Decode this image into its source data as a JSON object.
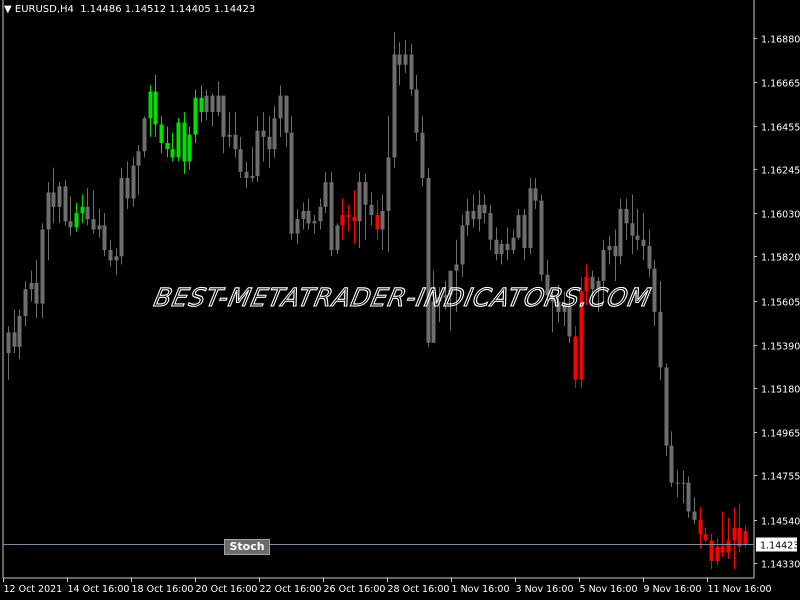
{
  "header": {
    "symbol_timeframe": "EURUSD,H4",
    "open": "1.14486",
    "high": "1.14512",
    "low": "1.14405",
    "close": "1.14423"
  },
  "colors": {
    "background": "#000000",
    "axis": "#c8c8c8",
    "neutral_candle": "#6e6e6e",
    "bull_signal_candle": "#00e000",
    "bear_signal_candle": "#ff0000",
    "price_line": "#7f8fa6",
    "watermark": "#ffffff"
  },
  "watermark_text": "BEST-METATRADER-INDICATORS.COM",
  "stoch_button_label": "Stoch",
  "current_price_label": "1.14423",
  "chart_data": {
    "type": "candlestick",
    "title": "EURUSD,H4",
    "ylim": [
      1.1418,
      1.1703
    ],
    "y_ticks": [
      "1.16880",
      "1.16665",
      "1.16455",
      "1.16245",
      "1.16030",
      "1.15820",
      "1.15605",
      "1.15390",
      "1.15180",
      "1.14965",
      "1.14755",
      "1.14540",
      "1.14330"
    ],
    "x_ticks": [
      "12 Oct 2021",
      "14 Oct 16:00",
      "18 Oct 16:00",
      "20 Oct 16:00",
      "22 Oct 16:00",
      "26 Oct 16:00",
      "28 Oct 16:00",
      "1 Nov 16:00",
      "3 Nov 16:00",
      "5 Nov 16:00",
      "9 Nov 16:00",
      "11 Nov 16:00"
    ],
    "current_price": 1.14423,
    "candles": [
      [
        1.1535,
        1.1548,
        1.1522,
        1.1545,
        "n"
      ],
      [
        1.1545,
        1.1556,
        1.1535,
        1.1538,
        "n"
      ],
      [
        1.1538,
        1.1556,
        1.1532,
        1.1553,
        "n"
      ],
      [
        1.1553,
        1.157,
        1.1548,
        1.1566,
        "n"
      ],
      [
        1.1566,
        1.1575,
        1.156,
        1.1569,
        "n"
      ],
      [
        1.1569,
        1.158,
        1.1552,
        1.1559,
        "n"
      ],
      [
        1.1559,
        1.1598,
        1.1552,
        1.1595,
        "n"
      ],
      [
        1.1595,
        1.1618,
        1.158,
        1.1613,
        "n"
      ],
      [
        1.1613,
        1.1625,
        1.1598,
        1.1606,
        "n"
      ],
      [
        1.1606,
        1.1618,
        1.1598,
        1.1616,
        "n"
      ],
      [
        1.1616,
        1.1619,
        1.1597,
        1.1599,
        "n"
      ],
      [
        1.1599,
        1.1611,
        1.1592,
        1.1596,
        "n"
      ],
      [
        1.1596,
        1.1608,
        1.1594,
        1.1603,
        "g"
      ],
      [
        1.1603,
        1.1612,
        1.1598,
        1.1606,
        "g"
      ],
      [
        1.1606,
        1.1615,
        1.1597,
        1.16,
        "n"
      ],
      [
        1.16,
        1.1614,
        1.1593,
        1.1595,
        "n"
      ],
      [
        1.1595,
        1.1605,
        1.1591,
        1.1597,
        "n"
      ],
      [
        1.1597,
        1.1603,
        1.1582,
        1.1585,
        "n"
      ],
      [
        1.1585,
        1.159,
        1.1577,
        1.158,
        "n"
      ],
      [
        1.158,
        1.1586,
        1.1573,
        1.1582,
        "n"
      ],
      [
        1.1582,
        1.1625,
        1.1578,
        1.162,
        "n"
      ],
      [
        1.162,
        1.1628,
        1.1605,
        1.161,
        "n"
      ],
      [
        1.161,
        1.163,
        1.1606,
        1.1626,
        "n"
      ],
      [
        1.1626,
        1.1636,
        1.1612,
        1.1633,
        "n"
      ],
      [
        1.1633,
        1.165,
        1.163,
        1.1649,
        "n"
      ],
      [
        1.1649,
        1.1665,
        1.164,
        1.1662,
        "g"
      ],
      [
        1.1662,
        1.167,
        1.164,
        1.1646,
        "g"
      ],
      [
        1.1646,
        1.165,
        1.1632,
        1.1637,
        "g"
      ],
      [
        1.1637,
        1.1645,
        1.163,
        1.1634,
        "g"
      ],
      [
        1.1634,
        1.1642,
        1.1628,
        1.163,
        "g"
      ],
      [
        1.163,
        1.1649,
        1.1628,
        1.1647,
        "g"
      ],
      [
        1.1647,
        1.1652,
        1.1622,
        1.1628,
        "g"
      ],
      [
        1.1628,
        1.1645,
        1.1624,
        1.1641,
        "g"
      ],
      [
        1.1641,
        1.1663,
        1.1637,
        1.1659,
        "g"
      ],
      [
        1.1659,
        1.1665,
        1.1647,
        1.1652,
        "g"
      ],
      [
        1.1652,
        1.1663,
        1.1648,
        1.166,
        "n"
      ],
      [
        1.166,
        1.1661,
        1.1645,
        1.1652,
        "n"
      ],
      [
        1.1652,
        1.1667,
        1.165,
        1.166,
        "n"
      ],
      [
        1.166,
        1.166,
        1.1632,
        1.164,
        "n"
      ],
      [
        1.164,
        1.1652,
        1.1635,
        1.1641,
        "n"
      ],
      [
        1.1641,
        1.1652,
        1.163,
        1.1634,
        "n"
      ],
      [
        1.1634,
        1.164,
        1.162,
        1.1623,
        "n"
      ],
      [
        1.1623,
        1.1628,
        1.1615,
        1.162,
        "n"
      ],
      [
        1.162,
        1.1635,
        1.1618,
        1.1621,
        "n"
      ],
      [
        1.1621,
        1.165,
        1.1618,
        1.1643,
        "n"
      ],
      [
        1.1643,
        1.1652,
        1.1628,
        1.164,
        "n"
      ],
      [
        1.164,
        1.165,
        1.1625,
        1.1634,
        "n"
      ],
      [
        1.1634,
        1.1655,
        1.163,
        1.1649,
        "n"
      ],
      [
        1.1649,
        1.1665,
        1.164,
        1.166,
        "n"
      ],
      [
        1.166,
        1.166,
        1.1635,
        1.1642,
        "n"
      ],
      [
        1.1642,
        1.165,
        1.159,
        1.1593,
        "n"
      ],
      [
        1.1593,
        1.1605,
        1.1588,
        1.16,
        "n"
      ],
      [
        1.16,
        1.1608,
        1.1595,
        1.1604,
        "n"
      ],
      [
        1.1604,
        1.161,
        1.1595,
        1.1598,
        "n"
      ],
      [
        1.1598,
        1.1602,
        1.1593,
        1.1599,
        "n"
      ],
      [
        1.1599,
        1.161,
        1.1595,
        1.1606,
        "n"
      ],
      [
        1.1606,
        1.1623,
        1.1603,
        1.1618,
        "n"
      ],
      [
        1.1618,
        1.1623,
        1.1582,
        1.1585,
        "n"
      ],
      [
        1.1585,
        1.1598,
        1.1583,
        1.1597,
        "n"
      ],
      [
        1.1597,
        1.161,
        1.159,
        1.1602,
        "r"
      ],
      [
        1.1602,
        1.1607,
        1.1594,
        1.1601,
        "r"
      ],
      [
        1.1601,
        1.1614,
        1.1588,
        1.1599,
        "r"
      ],
      [
        1.1599,
        1.1623,
        1.1586,
        1.1618,
        "n"
      ],
      [
        1.1618,
        1.1622,
        1.159,
        1.1607,
        "n"
      ],
      [
        1.1607,
        1.1613,
        1.1597,
        1.1602,
        "n"
      ],
      [
        1.1602,
        1.1609,
        1.159,
        1.1595,
        "r"
      ],
      [
        1.1595,
        1.1612,
        1.1585,
        1.1604,
        "n"
      ],
      [
        1.1604,
        1.165,
        1.1584,
        1.163,
        "n"
      ],
      [
        1.163,
        1.1691,
        1.1625,
        1.168,
        "n"
      ],
      [
        1.168,
        1.1686,
        1.1665,
        1.1675,
        "n"
      ],
      [
        1.1675,
        1.1687,
        1.1671,
        1.168,
        "n"
      ],
      [
        1.168,
        1.1685,
        1.166,
        1.1663,
        "n"
      ],
      [
        1.1663,
        1.167,
        1.1638,
        1.1642,
        "n"
      ],
      [
        1.1642,
        1.165,
        1.1616,
        1.162,
        "n"
      ],
      [
        1.162,
        1.1625,
        1.1538,
        1.154,
        "n"
      ],
      [
        1.154,
        1.1575,
        1.154,
        1.156,
        "n"
      ],
      [
        1.156,
        1.1567,
        1.155,
        1.1562,
        "n"
      ],
      [
        1.1562,
        1.157,
        1.1556,
        1.1563,
        "n"
      ],
      [
        1.1563,
        1.1573,
        1.1546,
        1.1575,
        "n"
      ],
      [
        1.1575,
        1.159,
        1.1555,
        1.1578,
        "n"
      ],
      [
        1.1578,
        1.1602,
        1.1572,
        1.1597,
        "n"
      ],
      [
        1.1597,
        1.161,
        1.1592,
        1.1604,
        "n"
      ],
      [
        1.1604,
        1.1612,
        1.1596,
        1.16,
        "n"
      ],
      [
        1.16,
        1.1614,
        1.1594,
        1.1607,
        "n"
      ],
      [
        1.1607,
        1.1612,
        1.1598,
        1.1603,
        "n"
      ],
      [
        1.1603,
        1.1607,
        1.1585,
        1.159,
        "n"
      ],
      [
        1.159,
        1.1596,
        1.158,
        1.1583,
        "n"
      ],
      [
        1.1583,
        1.159,
        1.1578,
        1.1588,
        "n"
      ],
      [
        1.1588,
        1.1596,
        1.158,
        1.1585,
        "n"
      ],
      [
        1.1585,
        1.1595,
        1.1583,
        1.1591,
        "n"
      ],
      [
        1.1591,
        1.1605,
        1.159,
        1.1602,
        "n"
      ],
      [
        1.1602,
        1.1605,
        1.158,
        1.1586,
        "n"
      ],
      [
        1.1586,
        1.162,
        1.1583,
        1.1615,
        "n"
      ],
      [
        1.1615,
        1.162,
        1.1605,
        1.1609,
        "n"
      ],
      [
        1.1609,
        1.1612,
        1.157,
        1.1573,
        "n"
      ],
      [
        1.1573,
        1.158,
        1.156,
        1.1563,
        "n"
      ],
      [
        1.1563,
        1.1566,
        1.1545,
        1.156,
        "n"
      ],
      [
        1.156,
        1.1568,
        1.155,
        1.1555,
        "n"
      ],
      [
        1.1555,
        1.1565,
        1.1548,
        1.1558,
        "n"
      ],
      [
        1.1558,
        1.1566,
        1.154,
        1.1543,
        "n"
      ],
      [
        1.1543,
        1.1548,
        1.1518,
        1.1522,
        "r"
      ],
      [
        1.1522,
        1.1572,
        1.1518,
        1.1565,
        "r"
      ],
      [
        1.1565,
        1.1578,
        1.1558,
        1.1572,
        "r"
      ],
      [
        1.1572,
        1.1575,
        1.1558,
        1.1566,
        "n"
      ],
      [
        1.1566,
        1.1572,
        1.1555,
        1.157,
        "n"
      ],
      [
        1.157,
        1.159,
        1.156,
        1.1585,
        "n"
      ],
      [
        1.1585,
        1.1592,
        1.1578,
        1.1587,
        "n"
      ],
      [
        1.1587,
        1.1595,
        1.157,
        1.1582,
        "n"
      ],
      [
        1.1582,
        1.161,
        1.1578,
        1.1605,
        "n"
      ],
      [
        1.1605,
        1.161,
        1.159,
        1.1598,
        "n"
      ],
      [
        1.1598,
        1.1612,
        1.1583,
        1.1592,
        "n"
      ],
      [
        1.1592,
        1.1605,
        1.1585,
        1.159,
        "n"
      ],
      [
        1.159,
        1.1603,
        1.158,
        1.1587,
        "n"
      ],
      [
        1.1587,
        1.1595,
        1.1572,
        1.1576,
        "n"
      ],
      [
        1.1576,
        1.158,
        1.1548,
        1.1555,
        "n"
      ],
      [
        1.1555,
        1.157,
        1.1522,
        1.1528,
        "n"
      ],
      [
        1.1528,
        1.153,
        1.1485,
        1.149,
        "n"
      ],
      [
        1.149,
        1.1497,
        1.147,
        1.1472,
        "n"
      ],
      [
        1.1472,
        1.1478,
        1.1465,
        1.1472,
        "n"
      ],
      [
        1.1472,
        1.1478,
        1.1462,
        1.1472,
        "n"
      ],
      [
        1.1472,
        1.1475,
        1.1455,
        1.1458,
        "n"
      ],
      [
        1.1458,
        1.1465,
        1.1452,
        1.1454,
        "n"
      ],
      [
        1.1454,
        1.146,
        1.144,
        1.1447,
        "r"
      ],
      [
        1.1447,
        1.145,
        1.1443,
        1.1444,
        "r"
      ],
      [
        1.1444,
        1.1447,
        1.143,
        1.1434,
        "r"
      ],
      [
        1.1434,
        1.1445,
        1.1432,
        1.1441,
        "r"
      ],
      [
        1.1441,
        1.1458,
        1.1436,
        1.1438,
        "r"
      ],
      [
        1.1438,
        1.1455,
        1.1435,
        1.1444,
        "r"
      ],
      [
        1.1444,
        1.146,
        1.143,
        1.145,
        "r"
      ],
      [
        1.145,
        1.1462,
        1.1438,
        1.1441,
        "r"
      ],
      [
        1.14486,
        1.14512,
        1.14405,
        1.14423,
        "r"
      ]
    ]
  }
}
